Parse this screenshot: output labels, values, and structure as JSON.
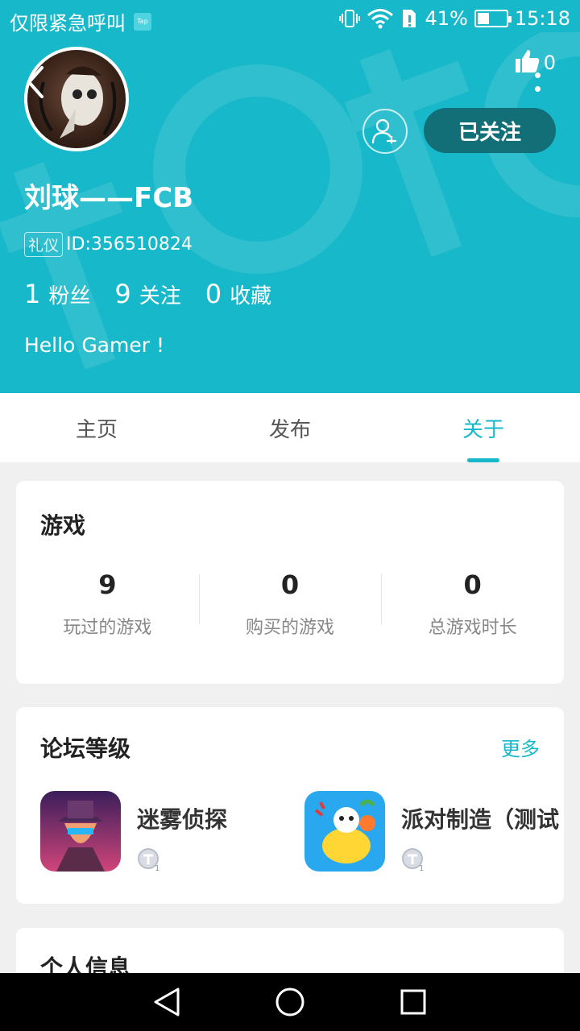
{
  "status_bar": {
    "carrier": "仅限紧急呼叫",
    "app_badge": "Tap",
    "battery_percent": "41%",
    "battery_level": 0.41,
    "time": "15:18"
  },
  "profile": {
    "like_count": "0",
    "follow_label": "已关注",
    "username": "刘球——FCB",
    "badge": "礼仪",
    "id_text": "ID:356510824",
    "stats": [
      {
        "num": "1",
        "label": "粉丝"
      },
      {
        "num": "9",
        "label": "关注"
      },
      {
        "num": "0",
        "label": "收藏"
      }
    ],
    "bio": "Hello Gamer !"
  },
  "tabs": [
    {
      "label": "主页"
    },
    {
      "label": "发布"
    },
    {
      "label": "关于",
      "active": true
    }
  ],
  "games": {
    "title": "游戏",
    "stats": [
      {
        "num": "9",
        "label": "玩过的游戏"
      },
      {
        "num": "0",
        "label": "购买的游戏"
      },
      {
        "num": "0",
        "label": "总游戏时长"
      }
    ]
  },
  "forum": {
    "title": "论坛等级",
    "more_label": "更多",
    "items": [
      {
        "name": "迷雾侦探",
        "icon": "detective-game-icon"
      },
      {
        "name": "派对制造（测试",
        "icon": "party-game-icon"
      }
    ]
  },
  "personal": {
    "title": "个人信息"
  },
  "colors": {
    "accent": "#17b8c9",
    "follow_button": "#136f77"
  }
}
